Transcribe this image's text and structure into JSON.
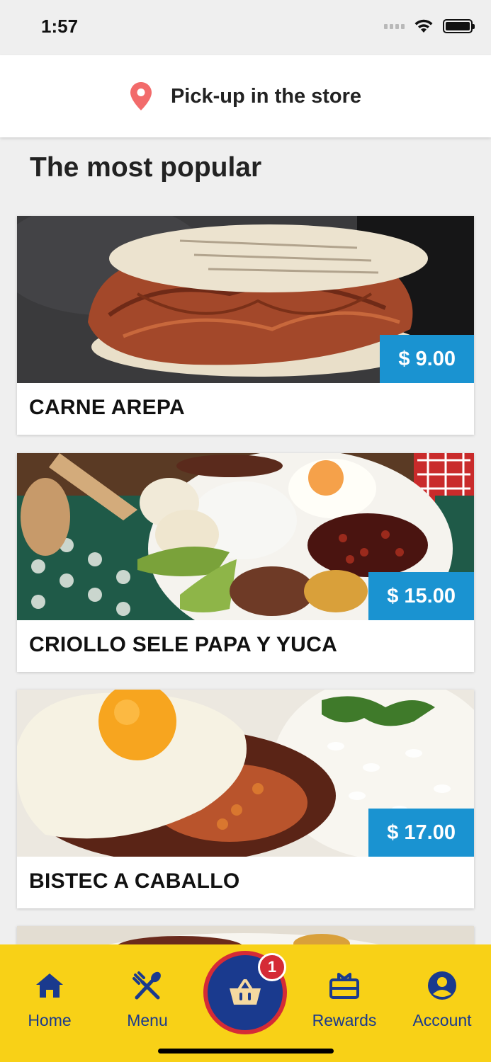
{
  "status_bar": {
    "time": "1:57"
  },
  "pickup": {
    "label": "Pick-up in the store",
    "icon": "location-pin-icon",
    "icon_color": "#f26b6b"
  },
  "section": {
    "title": "The most popular"
  },
  "products": [
    {
      "name": "CARNE AREPA",
      "price": "$ 9.00"
    },
    {
      "name": "CRIOLLO SELE PAPA Y YUCA",
      "price": "$ 15.00"
    },
    {
      "name": "BISTEC A CABALLO",
      "price": "$ 17.00"
    }
  ],
  "tab_bar": {
    "home": "Home",
    "menu": "Menu",
    "rewards": "Rewards",
    "account": "Account",
    "basket_count": "1"
  },
  "colors": {
    "accent_blue": "#1a93d1",
    "tab_bar_yellow": "#f8d117",
    "tab_icon_blue": "#1a3a8e",
    "basket_red": "#d52b36"
  }
}
